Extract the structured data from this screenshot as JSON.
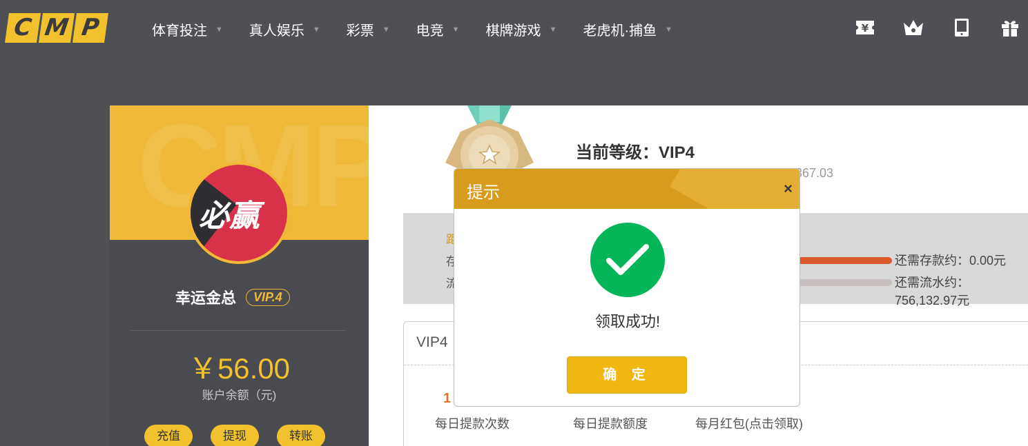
{
  "header": {
    "logo_letters": [
      "C",
      "M",
      "P"
    ],
    "nav": [
      {
        "label": "体育投注"
      },
      {
        "label": "真人娱乐"
      },
      {
        "label": "彩票"
      },
      {
        "label": "电竞"
      },
      {
        "label": "棋牌游戏"
      },
      {
        "label": "老虎机·捕鱼"
      }
    ],
    "icons": [
      "voucher-icon",
      "crown-icon",
      "tablet-icon",
      "gift-icon"
    ]
  },
  "profile": {
    "watermark": "CMP",
    "avatar_text": "必赢",
    "username": "幸运金总",
    "vip_badge": "VIP.4",
    "balance": "￥56.00",
    "balance_label": "账户余额（元)",
    "actions": [
      "充值",
      "提现",
      "转账"
    ]
  },
  "vip": {
    "current_level": "当前等级：VIP4",
    "sub_text_visible": "367.03",
    "progress_labels": [
      "距",
      "存",
      "流"
    ],
    "deposit_needed": "还需存款约：0.00元",
    "turnover_needed": "还需流水约：756,132.97元",
    "deposit_progress": 1.0,
    "turnover_progress": 0.0,
    "privilege_header": "VIP4",
    "privilege_value": "1",
    "privilege_labels": [
      "每日提款次数",
      "每日提款额度",
      "每月红包(点击领取)"
    ]
  },
  "modal": {
    "title": "提示",
    "close": "×",
    "message": "领取成功!",
    "confirm": "确 定"
  },
  "colors": {
    "accent": "#f2c12e",
    "modal_header": "#d89c1d",
    "success": "#06b55a",
    "deposit_bar": "#d9582c"
  }
}
